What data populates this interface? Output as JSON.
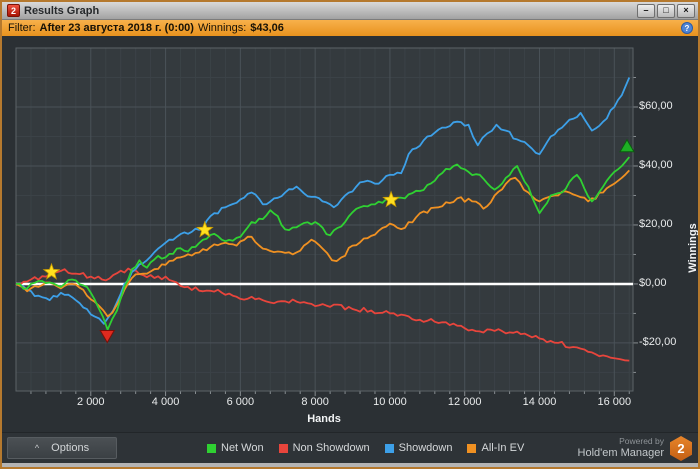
{
  "window": {
    "title": "Results Graph",
    "app_icon": "2",
    "controls": {
      "minimize": "–",
      "maximize": "□",
      "close": "×"
    }
  },
  "filter_bar": {
    "filter_label": "Filter:",
    "filter_value": "After 23 августа 2018 г. (0:00)",
    "winnings_label": "Winnings:",
    "winnings_value": "$43,06",
    "help_icon": "?"
  },
  "options_button": {
    "chevron": "^",
    "label": "Options"
  },
  "legend": [
    {
      "label": "Net Won",
      "color": "#2fd132"
    },
    {
      "label": "Non Showdown",
      "color": "#e8453c"
    },
    {
      "label": "Showdown",
      "color": "#3da0e8"
    },
    {
      "label": "All-In EV",
      "color": "#f09122"
    }
  ],
  "branding": {
    "powered_by": "Powered by",
    "name": "Hold'em Manager",
    "logo_text": "2"
  },
  "chart_data": {
    "type": "line",
    "xlabel": "Hands",
    "ylabel": "Winnings",
    "xlim": [
      0,
      16500
    ],
    "ylim": [
      -36.3,
      80
    ],
    "grid": {
      "x_minor_step": 400,
      "y_minor_step": 10,
      "x_major_step": 2000,
      "y_major_step": 20
    },
    "zero_line": 0,
    "x_ticks": [
      {
        "value": 2000,
        "label": "2 000"
      },
      {
        "value": 4000,
        "label": "4 000"
      },
      {
        "value": 6000,
        "label": "6 000"
      },
      {
        "value": 8000,
        "label": "8 000"
      },
      {
        "value": 10000,
        "label": "10 000"
      },
      {
        "value": 12000,
        "label": "12 000"
      },
      {
        "value": 14000,
        "label": "14 000"
      },
      {
        "value": 16000,
        "label": "16 000"
      }
    ],
    "y_ticks": [
      {
        "value": 60,
        "label": "$60,00"
      },
      {
        "value": 40,
        "label": "$40,00"
      },
      {
        "value": 20,
        "label": "$20,00"
      },
      {
        "value": 0,
        "label": "$0,00"
      },
      {
        "value": -20,
        "label": "-$20,00"
      }
    ],
    "series": [
      {
        "name": "Net Won",
        "color": "#2fd132",
        "points": [
          [
            0,
            0
          ],
          [
            300,
            -1.5
          ],
          [
            600,
            1
          ],
          [
            900,
            0.5
          ],
          [
            1200,
            -1
          ],
          [
            1500,
            1.5
          ],
          [
            1800,
            -0.5
          ],
          [
            2000,
            -3
          ],
          [
            2200,
            -8
          ],
          [
            2450,
            -15.5
          ],
          [
            2700,
            -9
          ],
          [
            2900,
            -1
          ],
          [
            3100,
            5
          ],
          [
            3300,
            8
          ],
          [
            3500,
            5.5
          ],
          [
            3800,
            9.5
          ],
          [
            4000,
            9
          ],
          [
            4300,
            12
          ],
          [
            4600,
            11
          ],
          [
            5000,
            15
          ],
          [
            5300,
            17
          ],
          [
            5600,
            14.5
          ],
          [
            6000,
            16
          ],
          [
            6300,
            21
          ],
          [
            6600,
            22
          ],
          [
            6800,
            25
          ],
          [
            7000,
            23
          ],
          [
            7200,
            18.5
          ],
          [
            7600,
            20
          ],
          [
            8000,
            21
          ],
          [
            8400,
            16.5
          ],
          [
            8800,
            21
          ],
          [
            9200,
            26
          ],
          [
            9600,
            27
          ],
          [
            10000,
            28.5
          ],
          [
            10400,
            29
          ],
          [
            10800,
            31.5
          ],
          [
            11200,
            35
          ],
          [
            11500,
            39
          ],
          [
            11800,
            40.5
          ],
          [
            12100,
            38
          ],
          [
            12400,
            37
          ],
          [
            12800,
            32
          ],
          [
            13100,
            36
          ],
          [
            13400,
            40
          ],
          [
            13700,
            33
          ],
          [
            14000,
            24
          ],
          [
            14300,
            30
          ],
          [
            14600,
            31
          ],
          [
            15000,
            37
          ],
          [
            15400,
            28
          ],
          [
            15700,
            33
          ],
          [
            16000,
            38
          ],
          [
            16200,
            40
          ],
          [
            16400,
            43
          ]
        ]
      },
      {
        "name": "Non Showdown",
        "color": "#e8453c",
        "points": [
          [
            0,
            0
          ],
          [
            400,
            1.5
          ],
          [
            800,
            2.5
          ],
          [
            1100,
            4
          ],
          [
            1300,
            5
          ],
          [
            1600,
            3.5
          ],
          [
            2000,
            2.5
          ],
          [
            2300,
            1.5
          ],
          [
            2600,
            3
          ],
          [
            2800,
            4.5
          ],
          [
            3100,
            4.5
          ],
          [
            3400,
            3
          ],
          [
            3700,
            2
          ],
          [
            4000,
            2.5
          ],
          [
            4300,
            0.5
          ],
          [
            4600,
            -1
          ],
          [
            5000,
            -2.5
          ],
          [
            5400,
            -2
          ],
          [
            5800,
            -4
          ],
          [
            6200,
            -5
          ],
          [
            6600,
            -5.5
          ],
          [
            7000,
            -6
          ],
          [
            7500,
            -6
          ],
          [
            8000,
            -7.5
          ],
          [
            8500,
            -7
          ],
          [
            9000,
            -8.5
          ],
          [
            9500,
            -9
          ],
          [
            10000,
            -10
          ],
          [
            10500,
            -11
          ],
          [
            11000,
            -12.5
          ],
          [
            11500,
            -13
          ],
          [
            12000,
            -15
          ],
          [
            12300,
            -16
          ],
          [
            12700,
            -15.5
          ],
          [
            13000,
            -16
          ],
          [
            13500,
            -17
          ],
          [
            14000,
            -18.5
          ],
          [
            14500,
            -20
          ],
          [
            15000,
            -21.5
          ],
          [
            15300,
            -23
          ],
          [
            15600,
            -24.5
          ],
          [
            15900,
            -25
          ],
          [
            16150,
            -25.5
          ],
          [
            16400,
            -26
          ]
        ]
      },
      {
        "name": "Showdown",
        "color": "#3da0e8",
        "points": [
          [
            0,
            0
          ],
          [
            300,
            -2
          ],
          [
            600,
            -4
          ],
          [
            900,
            -5.5
          ],
          [
            1200,
            -3
          ],
          [
            1500,
            -4.5
          ],
          [
            1800,
            -8
          ],
          [
            2100,
            -11
          ],
          [
            2350,
            -13.5
          ],
          [
            2600,
            -9
          ],
          [
            2900,
            0
          ],
          [
            3200,
            5
          ],
          [
            3500,
            8
          ],
          [
            3800,
            12
          ],
          [
            4000,
            14
          ],
          [
            4300,
            16
          ],
          [
            4600,
            17
          ],
          [
            5000,
            19
          ],
          [
            5300,
            24
          ],
          [
            5600,
            26
          ],
          [
            5900,
            27.5
          ],
          [
            6300,
            31
          ],
          [
            6600,
            27
          ],
          [
            6900,
            29
          ],
          [
            7200,
            31
          ],
          [
            7500,
            33
          ],
          [
            7900,
            29.5
          ],
          [
            8200,
            28
          ],
          [
            8500,
            26
          ],
          [
            8800,
            30
          ],
          [
            9100,
            33
          ],
          [
            9400,
            35
          ],
          [
            9700,
            34
          ],
          [
            10000,
            37
          ],
          [
            10300,
            37.5
          ],
          [
            10500,
            44
          ],
          [
            10700,
            46
          ],
          [
            11000,
            50
          ],
          [
            11400,
            53
          ],
          [
            11800,
            55
          ],
          [
            12100,
            54
          ],
          [
            12350,
            47
          ],
          [
            12600,
            51
          ],
          [
            12850,
            54
          ],
          [
            13100,
            52
          ],
          [
            13400,
            49
          ],
          [
            13700,
            47
          ],
          [
            14000,
            44
          ],
          [
            14300,
            50
          ],
          [
            14600,
            53
          ],
          [
            14900,
            56
          ],
          [
            15100,
            58
          ],
          [
            15400,
            52
          ],
          [
            15700,
            55
          ],
          [
            16000,
            60
          ],
          [
            16200,
            64
          ],
          [
            16400,
            70
          ]
        ]
      },
      {
        "name": "All-In EV",
        "color": "#f09122",
        "points": [
          [
            0,
            0
          ],
          [
            300,
            -2.5
          ],
          [
            600,
            -1
          ],
          [
            900,
            0.5
          ],
          [
            1200,
            -1.5
          ],
          [
            1500,
            0
          ],
          [
            1800,
            -2
          ],
          [
            2100,
            -6
          ],
          [
            2450,
            -11
          ],
          [
            2700,
            -7
          ],
          [
            2900,
            -2
          ],
          [
            3100,
            2
          ],
          [
            3400,
            3.5
          ],
          [
            3700,
            5
          ],
          [
            4000,
            6.5
          ],
          [
            4400,
            9
          ],
          [
            4800,
            10.5
          ],
          [
            5200,
            12.5
          ],
          [
            5600,
            14
          ],
          [
            5900,
            13
          ],
          [
            6300,
            16
          ],
          [
            6600,
            12
          ],
          [
            7000,
            11
          ],
          [
            7400,
            10
          ],
          [
            7700,
            13
          ],
          [
            7900,
            15
          ],
          [
            8200,
            12
          ],
          [
            8450,
            8
          ],
          [
            8700,
            9
          ],
          [
            9000,
            13
          ],
          [
            9400,
            15.5
          ],
          [
            9800,
            19
          ],
          [
            10100,
            20
          ],
          [
            10400,
            19
          ],
          [
            10800,
            24
          ],
          [
            11300,
            26
          ],
          [
            11800,
            29
          ],
          [
            12200,
            28
          ],
          [
            12500,
            25.5
          ],
          [
            12800,
            30
          ],
          [
            13100,
            34
          ],
          [
            13350,
            36
          ],
          [
            13700,
            31
          ],
          [
            14000,
            28
          ],
          [
            14400,
            30
          ],
          [
            14800,
            31
          ],
          [
            15300,
            28
          ],
          [
            15700,
            31
          ],
          [
            16000,
            34
          ],
          [
            16200,
            36
          ],
          [
            16400,
            38.5
          ]
        ]
      }
    ],
    "markers": [
      {
        "shape": "star",
        "hands": 950,
        "value": 4,
        "color": "#ffdf1f"
      },
      {
        "shape": "star",
        "hands": 5050,
        "value": 18.3,
        "color": "#ffdf1f"
      },
      {
        "shape": "star",
        "hands": 10030,
        "value": 28.5,
        "color": "#ffdf1f"
      },
      {
        "shape": "triangle-down",
        "hands": 2440,
        "value": -17.5,
        "color": "#e02a1f"
      },
      {
        "shape": "triangle-up",
        "hands": 16340,
        "value": 46.5,
        "color": "#1daf24"
      }
    ],
    "legend_position": "bottom",
    "grid_on": true
  }
}
